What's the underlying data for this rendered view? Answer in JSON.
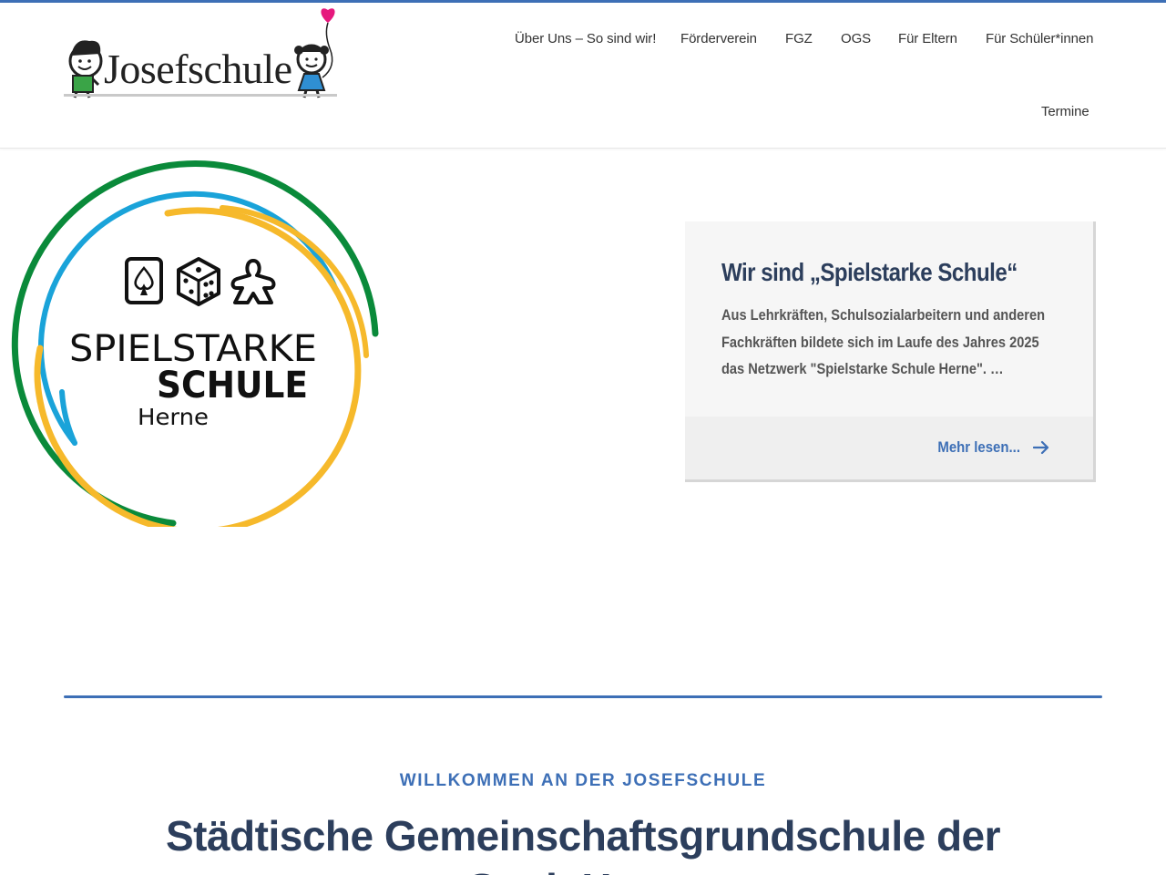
{
  "site": {
    "logo_text": "Josefschule"
  },
  "nav": {
    "items": [
      {
        "label": "Über Uns – So sind wir!"
      },
      {
        "label": "Förderverein"
      },
      {
        "label": "FGZ"
      },
      {
        "label": "OGS"
      },
      {
        "label": "Für Eltern"
      },
      {
        "label": "Für Schüler*innen"
      },
      {
        "label": "Termine"
      }
    ]
  },
  "hero_logo": {
    "line1": "SPIELSTARKE",
    "line2": "SCHULE",
    "line3": "Herne",
    "colors": {
      "outer": "#0a8a3a",
      "middle": "#1aa3d9",
      "inner": "#f6b92b"
    },
    "icons": [
      "card-spade-icon",
      "dice-icon",
      "meeple-icon"
    ]
  },
  "feature_card": {
    "title": "Wir sind „Spielstarke Schule“",
    "excerpt": "Aus Lehrkräften, Schulsozialarbeitern und anderen Fachkräften bildete sich im Laufe des Jahres 2025 das Netzwerk \"Spielstarke Schule Herne\". …",
    "read_more": "Mehr lesen..."
  },
  "welcome": {
    "kicker": "WILLKOMMEN AN DER JOSEFSCHULE",
    "headline": "Städtische Gemeinschaftsgrundschule der Stadt Herne"
  },
  "theme": {
    "accent": "#3d6fb6",
    "heading": "#2c3e5c",
    "balloon": "#e6187d"
  }
}
